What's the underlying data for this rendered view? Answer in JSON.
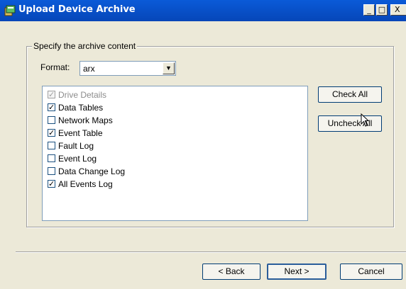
{
  "window": {
    "title": "Upload Device Archive",
    "minimize_glyph": "_",
    "maximize_glyph": "□",
    "close_glyph": "X"
  },
  "group": {
    "legend": "Specify the archive content"
  },
  "format": {
    "label": "Format:",
    "value": "arx"
  },
  "list": {
    "items": [
      {
        "label": "Drive Details",
        "checked": true,
        "disabled": true
      },
      {
        "label": "Data Tables",
        "checked": true,
        "disabled": false
      },
      {
        "label": "Network Maps",
        "checked": false,
        "disabled": false
      },
      {
        "label": "Event Table",
        "checked": true,
        "disabled": false
      },
      {
        "label": "Fault Log",
        "checked": false,
        "disabled": false
      },
      {
        "label": "Event Log",
        "checked": false,
        "disabled": false
      },
      {
        "label": "Data Change Log",
        "checked": false,
        "disabled": false
      },
      {
        "label": "All Events Log",
        "checked": true,
        "disabled": false
      }
    ]
  },
  "buttons": {
    "check_all": "Check All",
    "uncheck_all": "Uncheck All",
    "back": "< Back",
    "next": "Next >",
    "cancel": "Cancel"
  },
  "colors": {
    "titlebar": "#0646b8",
    "dialog_bg": "#ece9d8",
    "accent": "#2a5d9a"
  }
}
